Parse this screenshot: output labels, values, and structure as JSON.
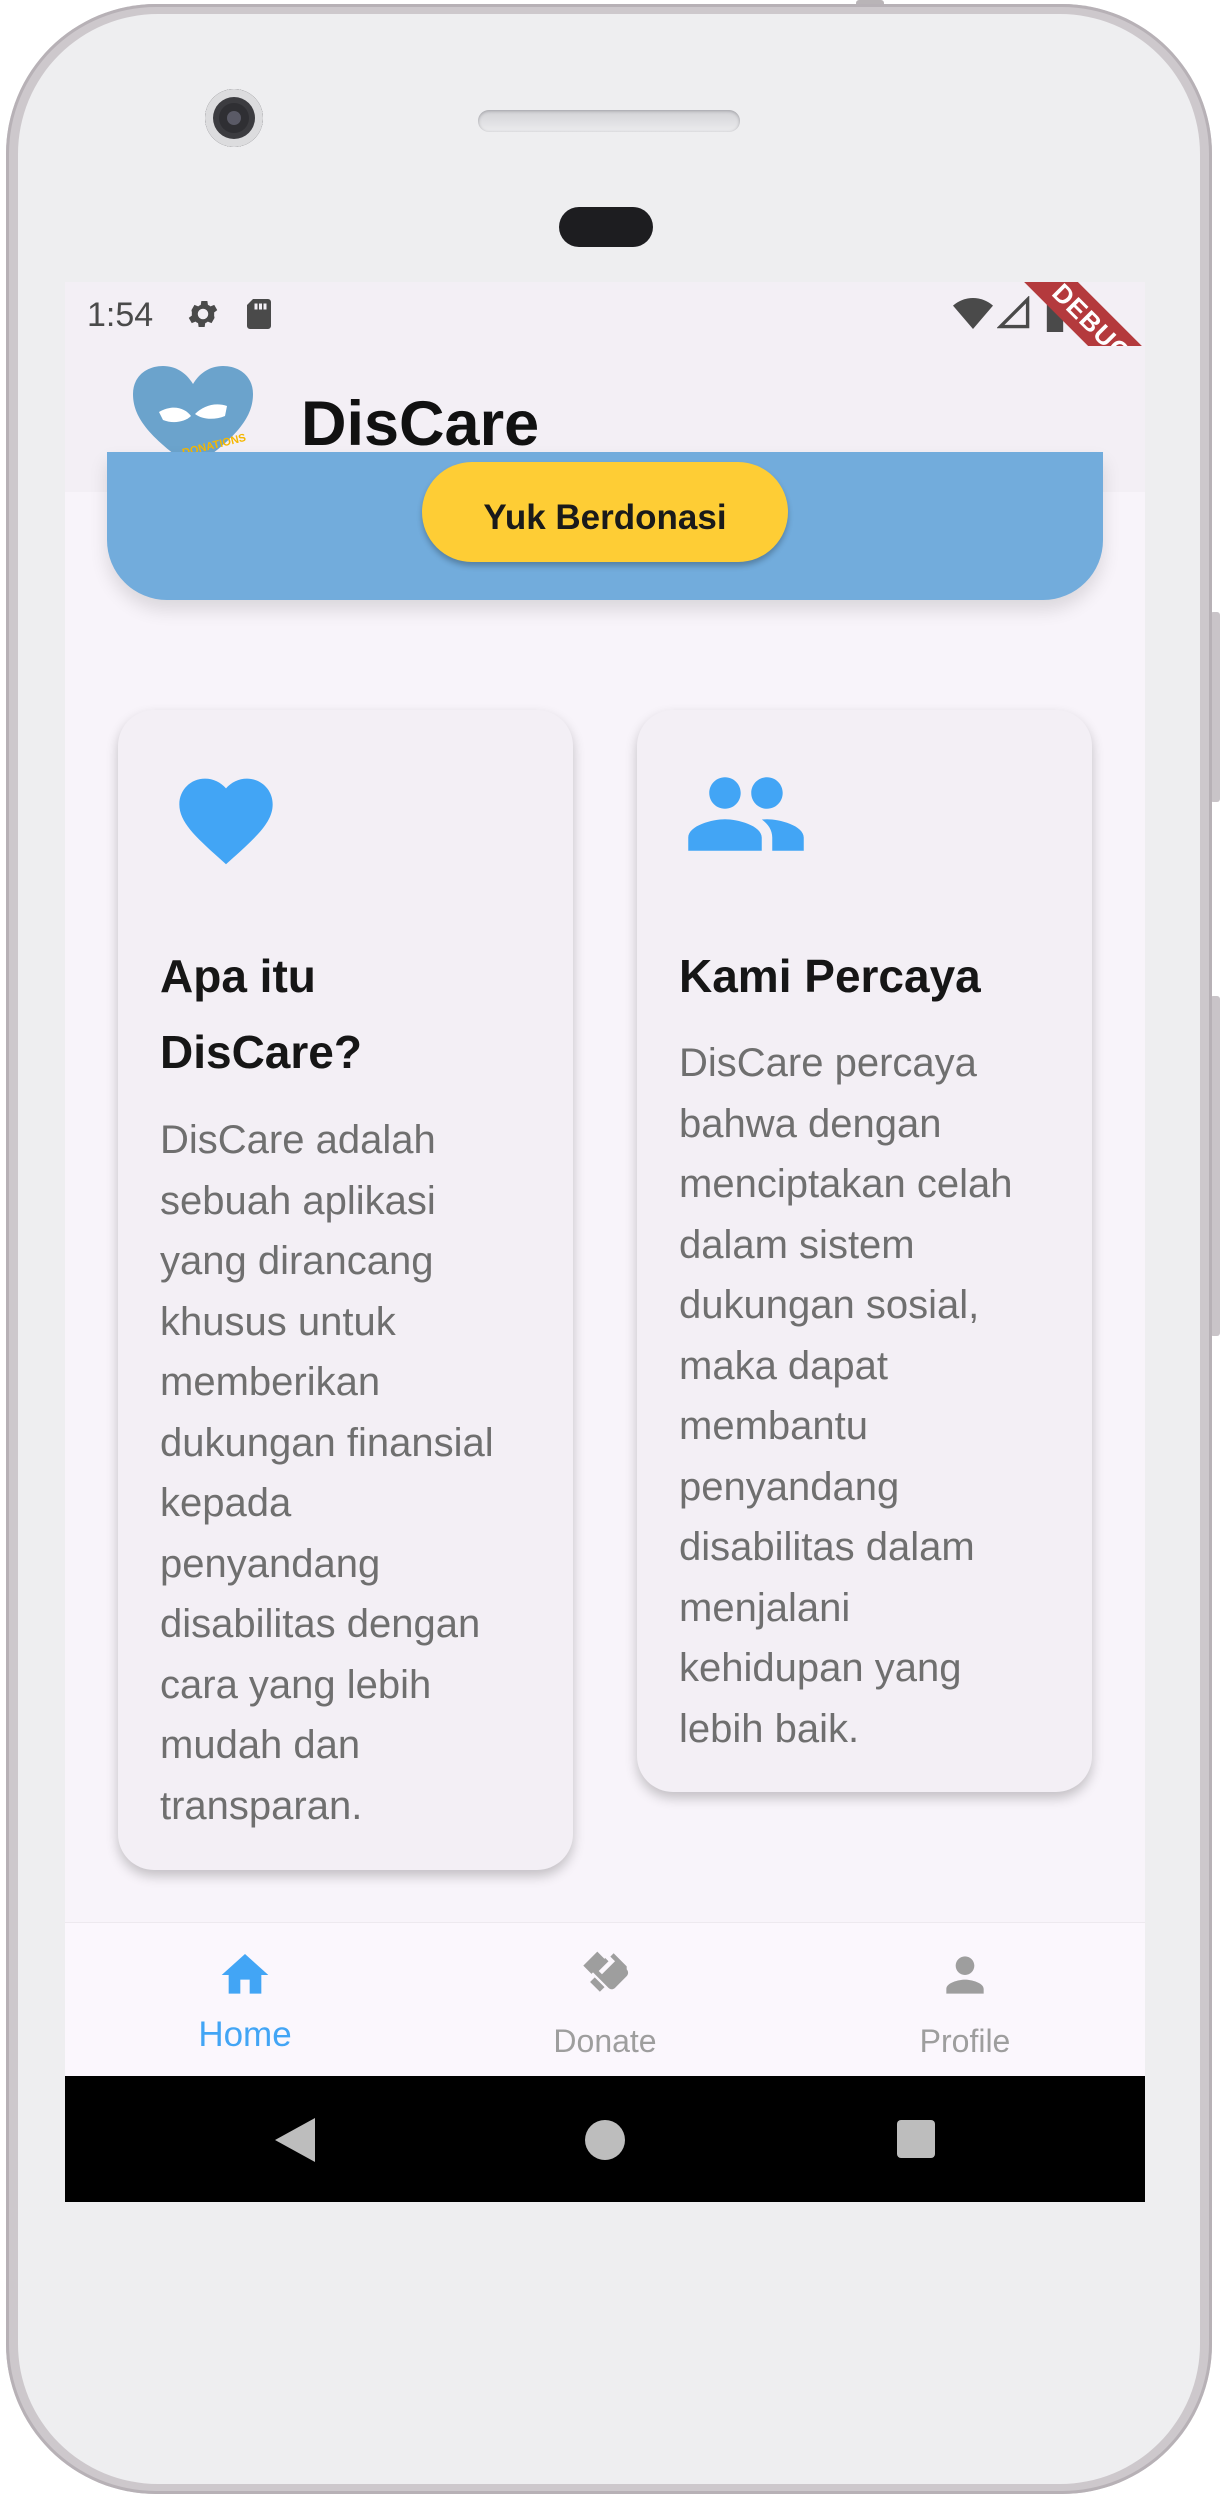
{
  "status_bar": {
    "time": "1:54"
  },
  "app_bar": {
    "title": "DisCare",
    "debug_banner": "DEBUG",
    "logo_text": "CALL for DONATIONS"
  },
  "hero": {
    "cta_label": "Yuk Berdonasi"
  },
  "cards": [
    {
      "icon": "heart-icon",
      "title_lines": [
        "Apa itu",
        "DisCare?"
      ],
      "text_lines": [
        "DisCare adalah",
        "sebuah aplikasi",
        "yang dirancang",
        "khusus untuk",
        "memberikan",
        "dukungan finansial",
        "kepada",
        "penyandang",
        "disabilitas dengan",
        "cara yang lebih",
        "mudah dan",
        "transparan."
      ]
    },
    {
      "icon": "people-icon",
      "title_lines": [
        "Kami Percaya"
      ],
      "text_lines": [
        "DisCare percaya",
        "bahwa dengan",
        "menciptakan celah",
        "dalam sistem",
        "dukungan sosial,",
        "maka dapat",
        "membantu",
        "penyandang",
        "disabilitas dalam",
        "menjalani",
        "kehidupan yang",
        "lebih baik."
      ]
    }
  ],
  "bottom_nav": {
    "items": [
      {
        "label": "Home",
        "icon": "home-icon",
        "active": true
      },
      {
        "label": "Donate",
        "icon": "handshake-icon",
        "active": false
      },
      {
        "label": "Profile",
        "icon": "person-icon",
        "active": false
      }
    ]
  },
  "colors": {
    "accent_blue": "#42a5f5",
    "hero_blue": "#72acdc",
    "cta_yellow": "#fecd35",
    "inactive_gray": "#9e9e9e",
    "debug_red": "#b43a3d"
  }
}
